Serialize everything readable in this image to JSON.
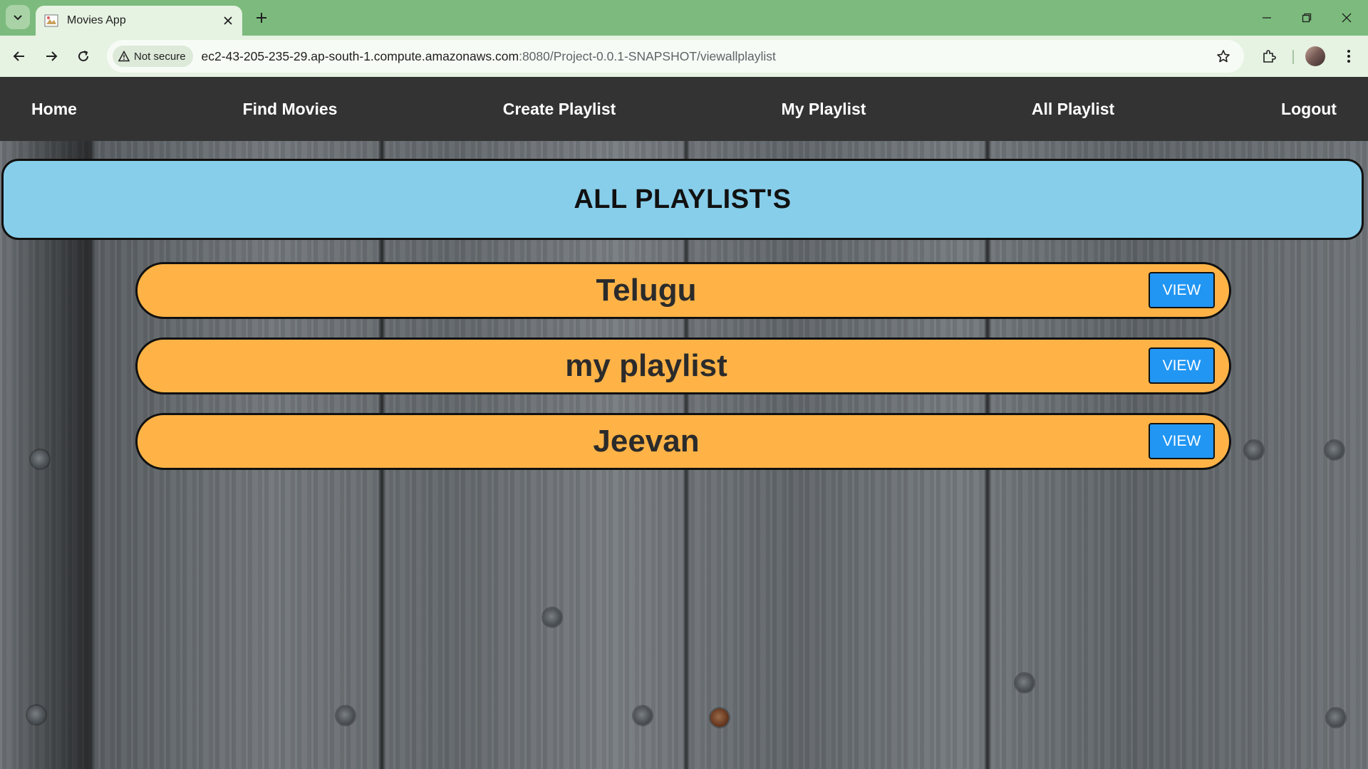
{
  "browser": {
    "tab_title": "Movies App",
    "security_label": "Not secure",
    "url_host": "ec2-43-205-235-29.ap-south-1.compute.amazonaws.com",
    "url_path": ":8080/Project-0.0.1-SNAPSHOT/viewallplaylist"
  },
  "nav": {
    "home": "Home",
    "find_movies": "Find Movies",
    "create_playlist": "Create Playlist",
    "my_playlist": "My Playlist",
    "all_playlist": "All Playlist",
    "logout": "Logout"
  },
  "page": {
    "heading": "ALL PLAYLIST'S",
    "view_label": "VIEW",
    "playlists": [
      {
        "name": "Telugu"
      },
      {
        "name": "my playlist"
      },
      {
        "name": "Jeevan"
      }
    ]
  },
  "colors": {
    "chrome_accent": "#7cbb7d",
    "nav_background": "#333333",
    "banner_background": "#87ceeb",
    "playlist_background": "#ffb347",
    "view_button": "#2196f3"
  },
  "icons": [
    "tab-search-icon",
    "favicon-icon",
    "close-icon",
    "plus-icon",
    "back-arrow-icon",
    "forward-arrow-icon",
    "reload-icon",
    "warning-icon",
    "star-icon",
    "extensions-icon",
    "kebab-menu-icon",
    "minimize-icon",
    "restore-icon"
  ]
}
